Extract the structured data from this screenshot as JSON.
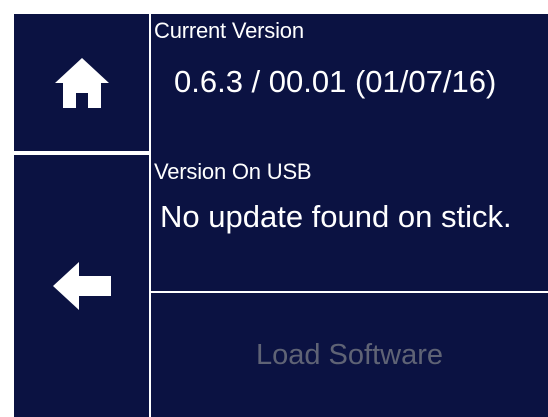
{
  "nav": {
    "home_icon": "home-icon",
    "back_icon": "arrow-left-icon"
  },
  "version": {
    "current_label": "Current Version",
    "current_value": "0.6.3 / 00.01 (01/07/16)",
    "usb_label": "Version On USB",
    "usb_value": "No update found on stick."
  },
  "actions": {
    "load_label": "Load Software",
    "load_enabled": false
  },
  "colors": {
    "panel": "#0b1242",
    "text": "#ffffff",
    "disabled_text": "#5f6375"
  }
}
